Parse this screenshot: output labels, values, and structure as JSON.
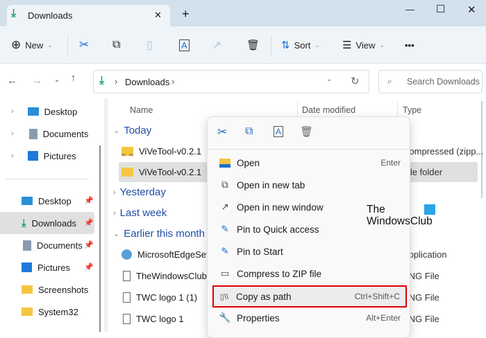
{
  "window": {
    "tab_title": "Downloads",
    "new_tab": "+",
    "minimize": "—",
    "maximize": "☐",
    "close": "✕",
    "tab_close": "✕"
  },
  "toolbar": {
    "new_label": "New",
    "sort_label": "Sort",
    "view_label": "View",
    "more": "•••"
  },
  "address": {
    "path": "Downloads",
    "search_placeholder": "Search Downloads"
  },
  "sidebar": {
    "top": [
      {
        "label": "Desktop"
      },
      {
        "label": "Documents"
      },
      {
        "label": "Pictures"
      }
    ],
    "pinned": [
      {
        "label": "Desktop",
        "pinned": true
      },
      {
        "label": "Downloads",
        "pinned": true,
        "selected": true
      },
      {
        "label": "Documents",
        "pinned": true
      },
      {
        "label": "Pictures",
        "pinned": true
      },
      {
        "label": "Screenshots"
      },
      {
        "label": "System32"
      }
    ]
  },
  "columns": {
    "name": "Name",
    "date": "Date modified",
    "type": "Type"
  },
  "groups": {
    "today": "Today",
    "yesterday": "Yesterday",
    "last_week": "Last week",
    "earlier": "Earlier this month"
  },
  "files": [
    {
      "name": "ViVeTool-v0.2.1",
      "type": "Compressed (zipp..."
    },
    {
      "name": "ViVeTool-v0.2.1",
      "type": "File folder"
    },
    {
      "name": "MicrosoftEdgeSetup",
      "type": "Application"
    },
    {
      "name": "TheWindowsClub",
      "type": "PNG File"
    },
    {
      "name": "TWC logo 1 (1)",
      "type": "PNG File"
    },
    {
      "name": "TWC logo 1",
      "type": "PNG File"
    }
  ],
  "context_menu": {
    "items": [
      {
        "label": "Open",
        "shortcut": "Enter"
      },
      {
        "label": "Open in new tab",
        "shortcut": ""
      },
      {
        "label": "Open in new window",
        "shortcut": ""
      },
      {
        "label": "Pin to Quick access",
        "shortcut": ""
      },
      {
        "label": "Pin to Start",
        "shortcut": ""
      },
      {
        "label": "Compress to ZIP file",
        "shortcut": ""
      },
      {
        "label": "Copy as path",
        "shortcut": "Ctrl+Shift+C",
        "highlighted": true
      },
      {
        "label": "Properties",
        "shortcut": "Alt+Enter"
      }
    ]
  },
  "watermark": {
    "line1": "The",
    "line2": "WindowsClub"
  },
  "colors": {
    "accent": "#1e6fd0",
    "highlight_border": "#e00000",
    "download_green": "#1aa260"
  }
}
